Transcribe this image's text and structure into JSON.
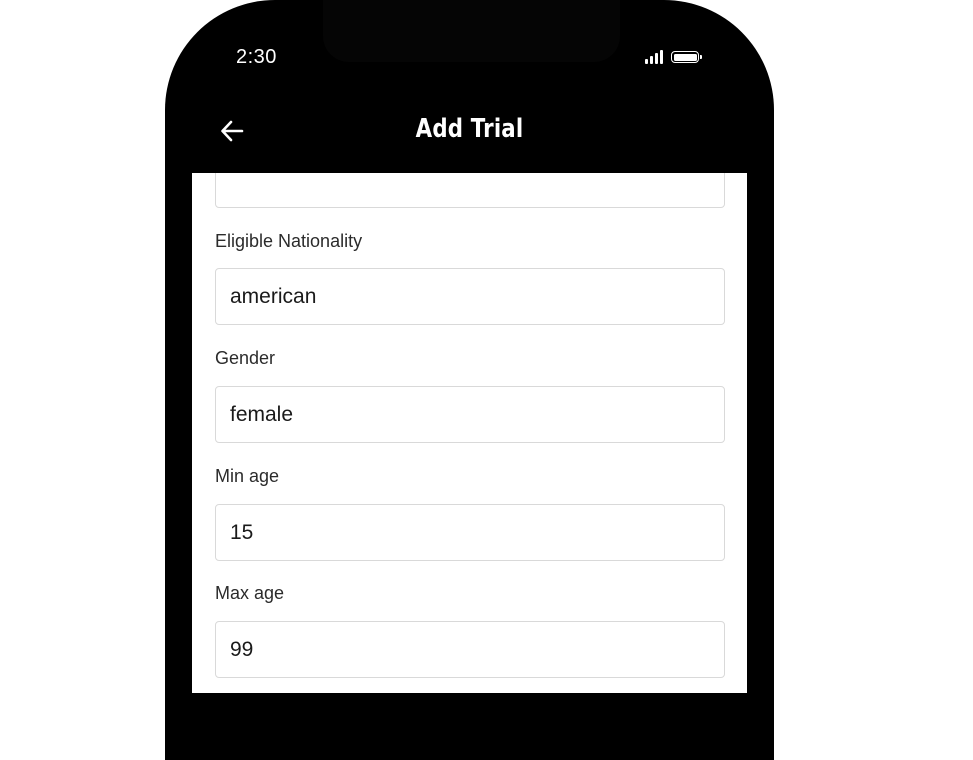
{
  "status_bar": {
    "time": "2:30",
    "signal_icon": "signal-bars-icon",
    "battery_icon": "battery-icon"
  },
  "app_bar": {
    "back_icon": "arrow-left-icon",
    "title": "Add Trial"
  },
  "form": {
    "eligible_nationality": {
      "label": "Eligible Nationality",
      "value": "american"
    },
    "gender": {
      "label": "Gender",
      "value": "female"
    },
    "min_age": {
      "label": "Min age",
      "value": "15"
    },
    "max_age": {
      "label": "Max age",
      "value": "99"
    }
  }
}
